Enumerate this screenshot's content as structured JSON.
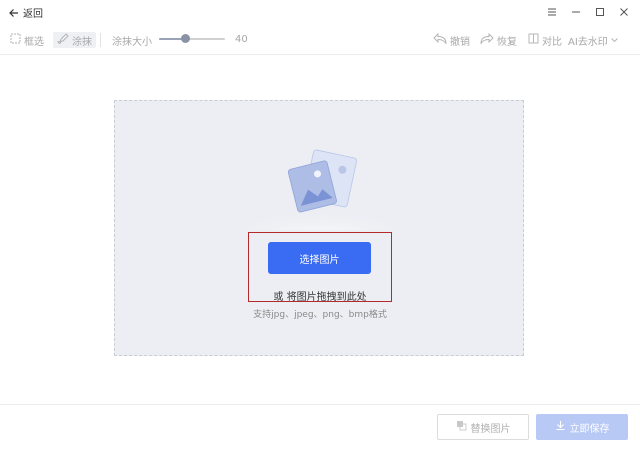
{
  "titlebar": {
    "back_label": "返回"
  },
  "toolbar": {
    "frame_select": "框选",
    "paint": "涂抹",
    "brush_size_label": "涂抹大小",
    "brush_size_value": "40",
    "brush_size_fraction": 0.4,
    "undo": "撤销",
    "redo": "恢复",
    "compare": "对比",
    "ai_remove": "AI去水印"
  },
  "dropzone": {
    "choose_button": "选择图片",
    "drag_hint": "或 将图片拖拽到此处",
    "formats_hint": "支持jpg、jpeg、png、bmp格式"
  },
  "footer": {
    "replace_button": "替换图片",
    "save_button": "立即保存"
  },
  "colors": {
    "accent": "#3a6cf3",
    "highlight_border": "#b42a2a",
    "dropzone_bg": "#eceef3"
  }
}
